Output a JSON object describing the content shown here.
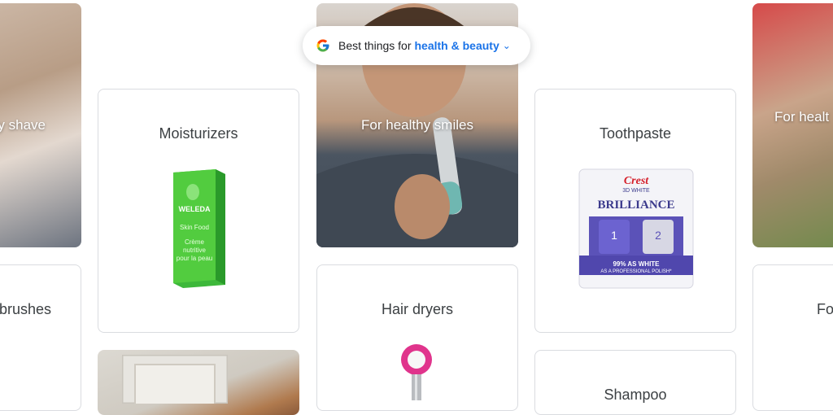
{
  "search_pill": {
    "prefix": "Best things for",
    "topic": "health & beauty",
    "chevron_icon": "chevron-down-icon",
    "logo_icon": "google-g-icon"
  },
  "cards": {
    "left_top_caption": "y shave",
    "left_bottom_title": "brushes",
    "moisturizers_title": "Moisturizers",
    "smiles_caption": "For healthy smiles",
    "hair_dryers_title": "Hair dryers",
    "toothpaste_title": "Toothpaste",
    "shampoo_title": "Shampoo",
    "right_top_caption": "For healt",
    "right_bottom_title": "Fo"
  },
  "products": {
    "weleda": {
      "brand": "WELEDA",
      "line1": "Skin Food",
      "line2": "Crème",
      "line3": "nutritive",
      "line4": "pour la peau"
    },
    "crest": {
      "brand": "Crest",
      "sub": "3D WHITE",
      "name": "BRILLIANCE",
      "step1": "1",
      "step2": "2",
      "claim1": "99% AS WHITE",
      "claim2": "AS A PROFESSIONAL POLISH*"
    }
  }
}
